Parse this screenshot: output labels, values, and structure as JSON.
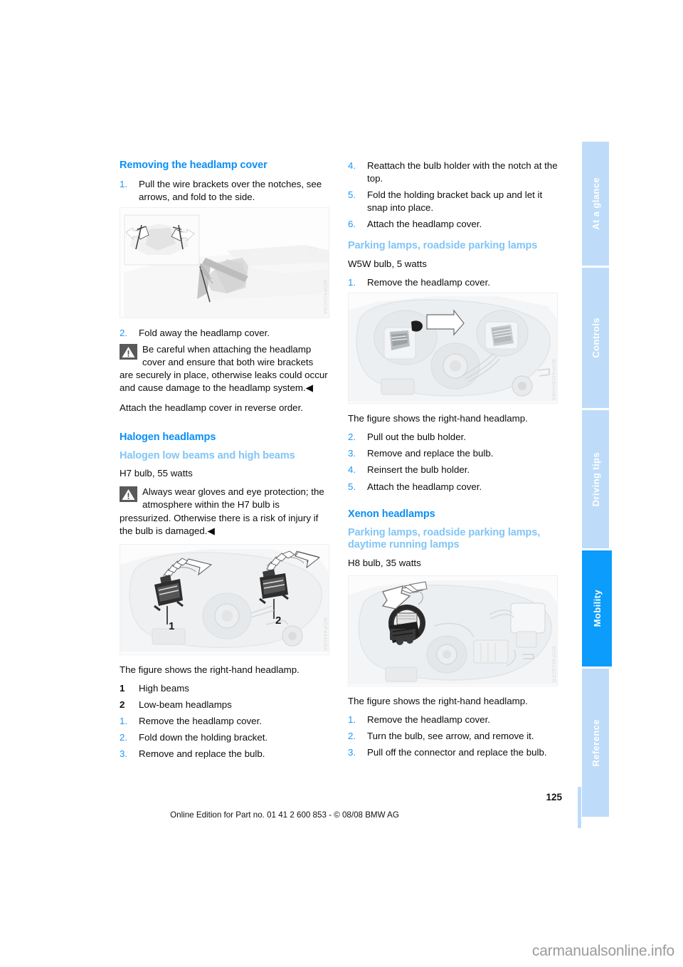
{
  "document": {
    "page_number": "125",
    "footer_line": "Online Edition for Part no. 01 41 2 600 853 - © 08/08 BMW AG",
    "watermark": "carmanualsonline.info"
  },
  "tabs": [
    {
      "label": "At a glance",
      "active": false
    },
    {
      "label": "Controls",
      "active": false
    },
    {
      "label": "Driving tips",
      "active": false
    },
    {
      "label": "Mobility",
      "active": true
    },
    {
      "label": "Reference",
      "active": false
    }
  ],
  "left_column": {
    "heading": "Removing the headlamp cover",
    "step1": {
      "num": "1.",
      "text": "Pull the wire brackets over the notches, see arrows, and fold to the side."
    },
    "figure1": {
      "id": "WOP41HCRA",
      "alt": "headlamp cover wire brackets detail"
    },
    "step2": {
      "num": "2.",
      "text": "Fold away the headlamp cover."
    },
    "warning1": {
      "icon": "warning-triangle-icon",
      "text": "Be careful when attaching the headlamp cover and ensure that both wire brackets are securely in place, otherwise leaks could occur and cause damage to the headlamp system.",
      "end_mark": "◀"
    },
    "note": "Attach the headlamp cover in reverse order.",
    "heading2": "Halogen headlamps",
    "subheading2": "Halogen low beams and high beams",
    "bulb_spec": "H7 bulb, 55 watts",
    "warning2": {
      "icon": "warning-triangle-icon",
      "text": "Always wear gloves and eye protection; the atmosphere within the H7 bulb is pressurized. Otherwise there is a risk of injury if the bulb is damaged.",
      "end_mark": "◀"
    },
    "figure2": {
      "id": "WOP4442MA",
      "callout_1": "1",
      "callout_2": "2",
      "alt": "halogen low and high beam bulb holders"
    },
    "figure_caption": "The figure shows the right-hand headlamp.",
    "legend": [
      {
        "num": "1",
        "text": "High beams"
      },
      {
        "num": "2",
        "text": "Low-beam headlamps"
      }
    ],
    "steps": [
      {
        "num": "1.",
        "text": "Remove the headlamp cover."
      },
      {
        "num": "2.",
        "text": "Fold down the holding bracket."
      },
      {
        "num": "3.",
        "text": "Remove and replace the bulb."
      }
    ]
  },
  "right_column": {
    "steps_top": [
      {
        "num": "4.",
        "text": "Reattach the bulb holder with the notch at the top."
      },
      {
        "num": "5.",
        "text": "Fold the holding bracket back up and let it snap into place."
      },
      {
        "num": "6.",
        "text": "Attach the headlamp cover."
      }
    ],
    "subheading1": "Parking lamps, roadside parking lamps",
    "bulb_spec1": "W5W bulb, 5 watts",
    "step1": {
      "num": "1.",
      "text": "Remove the headlamp cover."
    },
    "figure1": {
      "id": "WOP4428HHMA",
      "alt": "parking lamp bulb holder location"
    },
    "figure_caption1": "The figure shows the right-hand headlamp.",
    "steps_mid": [
      {
        "num": "2.",
        "text": "Pull out the bulb holder."
      },
      {
        "num": "3.",
        "text": "Remove and replace the bulb."
      },
      {
        "num": "4.",
        "text": "Reinsert the bulb holder."
      },
      {
        "num": "5.",
        "text": "Attach the headlamp cover."
      }
    ],
    "heading2": "Xenon headlamps",
    "subheading2": "Parking lamps, roadside parking lamps, daytime running lamps",
    "bulb_spec2": "H8 bulb, 35 watts",
    "figure2": {
      "id": "WOP4514GFR",
      "alt": "xenon parking lamp bulb and connector"
    },
    "figure_caption2": "The figure shows the right-hand headlamp.",
    "steps_bottom": [
      {
        "num": "1.",
        "text": "Remove the headlamp cover."
      },
      {
        "num": "2.",
        "text": "Turn the bulb, see arrow, and remove it."
      },
      {
        "num": "3.",
        "text": "Pull off the connector and replace the bulb."
      }
    ]
  },
  "colors": {
    "heading_blue": "#0b8ff5",
    "subheading_blue": "#81c5f7",
    "step_number_blue": "#2196f3",
    "tab_inactive": "#bedcfa",
    "tab_active": "#0b9cfc"
  }
}
